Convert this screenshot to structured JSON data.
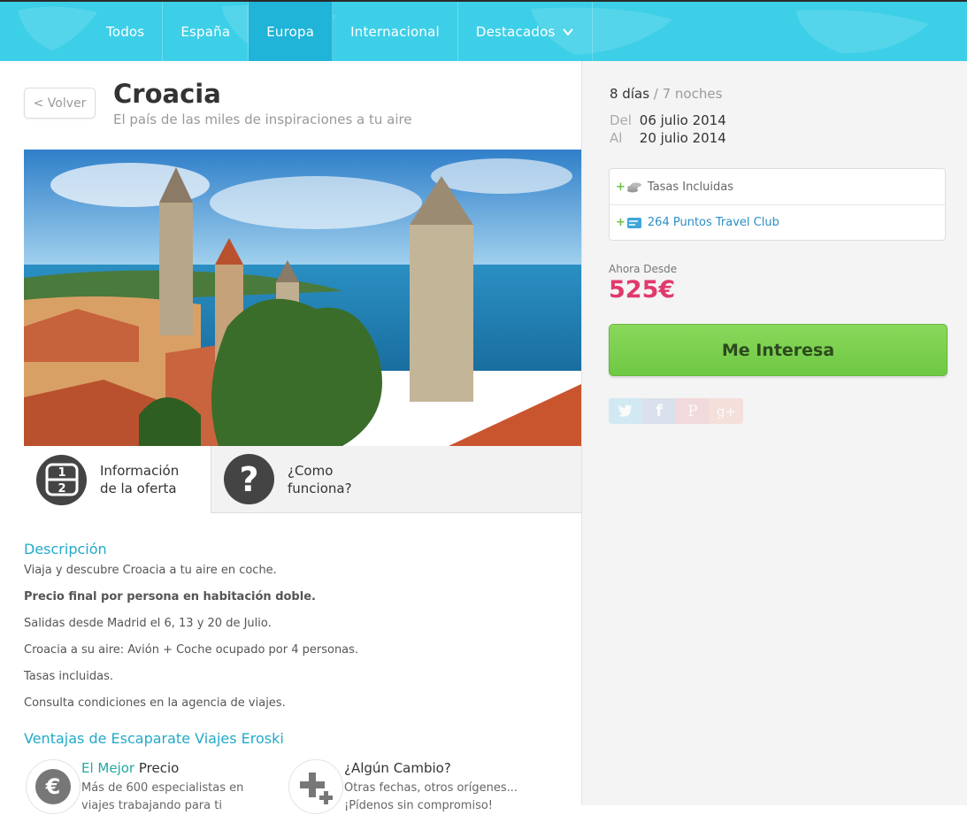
{
  "nav": {
    "items": [
      {
        "label": "Todos",
        "active": false
      },
      {
        "label": "España",
        "active": false
      },
      {
        "label": "Europa",
        "active": true
      },
      {
        "label": "Internacional",
        "active": false
      },
      {
        "label": "Destacados",
        "active": false,
        "icon": "chevron-down-icon"
      }
    ]
  },
  "header": {
    "back_label": "< Volver",
    "title": "Croacia",
    "subtitle": "El país de las miles de inspiraciones a tu aire"
  },
  "tabs": [
    {
      "label_line1": "Información",
      "label_line2": "de la oferta",
      "icon": "half-icon",
      "icon_top": "1",
      "icon_bottom": "2",
      "active": true
    },
    {
      "label_line1": "¿Como",
      "label_line2": "funciona?",
      "icon": "question-icon",
      "icon_glyph": "?",
      "active": false
    }
  ],
  "description": {
    "heading": "Descripción",
    "lines": [
      {
        "text": "Viaja y descubre Croacia a tu aire en coche.",
        "bold": false
      },
      {
        "text": "Precio final por persona en habitación doble.",
        "bold": true
      },
      {
        "text": "Salidas desde Madrid el 6, 13 y 20 de Julio.",
        "bold": false
      },
      {
        "text": "Croacia a su aire: Avión + Coche ocupado por 4 personas.",
        "bold": false
      },
      {
        "text": "Tasas incluidas.",
        "bold": false
      },
      {
        "text": "Consulta condiciones en la agencia de viajes.",
        "bold": false
      }
    ]
  },
  "advantages": {
    "heading": "Ventajas de Escaparate Viajes Eroski",
    "items": [
      {
        "title_highlight": "El Mejor",
        "title_rest": " Precio",
        "text_line1": "Más de 600 especialistas en",
        "text_line2": "viajes trabajando para ti",
        "icon": "euro-icon",
        "icon_glyph": "€"
      },
      {
        "title_highlight": "",
        "title_rest": "¿Algún Cambio?",
        "text_line1": "Otras fechas, otros orígenes...",
        "text_line2": "¡Pídenos sin compromiso!",
        "icon": "plus-icon"
      }
    ]
  },
  "sidebar": {
    "days": "8 días",
    "nights": "/ 7 noches",
    "from_label": "Del",
    "from_date": "06 julio 2014",
    "to_label": "Al",
    "to_date": "20 julio 2014",
    "extras": [
      {
        "plus": "+",
        "label": "Tasas Incluidas",
        "icon": "coins-icon"
      },
      {
        "plus": "+",
        "label": "264 Puntos Travel Club",
        "icon": "travel-club-card-icon"
      }
    ],
    "price_label": "Ahora Desde",
    "price": "525€",
    "cta_label": "Me Interesa",
    "social": [
      {
        "name": "twitter",
        "icon": "twitter-icon"
      },
      {
        "name": "facebook",
        "icon": "facebook-icon",
        "glyph": "f"
      },
      {
        "name": "pinterest",
        "icon": "pinterest-icon",
        "glyph": "P"
      },
      {
        "name": "google-plus",
        "icon": "google-plus-icon",
        "glyph": "g+"
      }
    ]
  },
  "colors": {
    "nav_bg": "#3dcfe8",
    "nav_active": "#1fb4d8",
    "accent_teal": "#22a9c8",
    "price": "#e03a6b",
    "cta": "#7bd04f",
    "link": "#2b8fc6"
  }
}
